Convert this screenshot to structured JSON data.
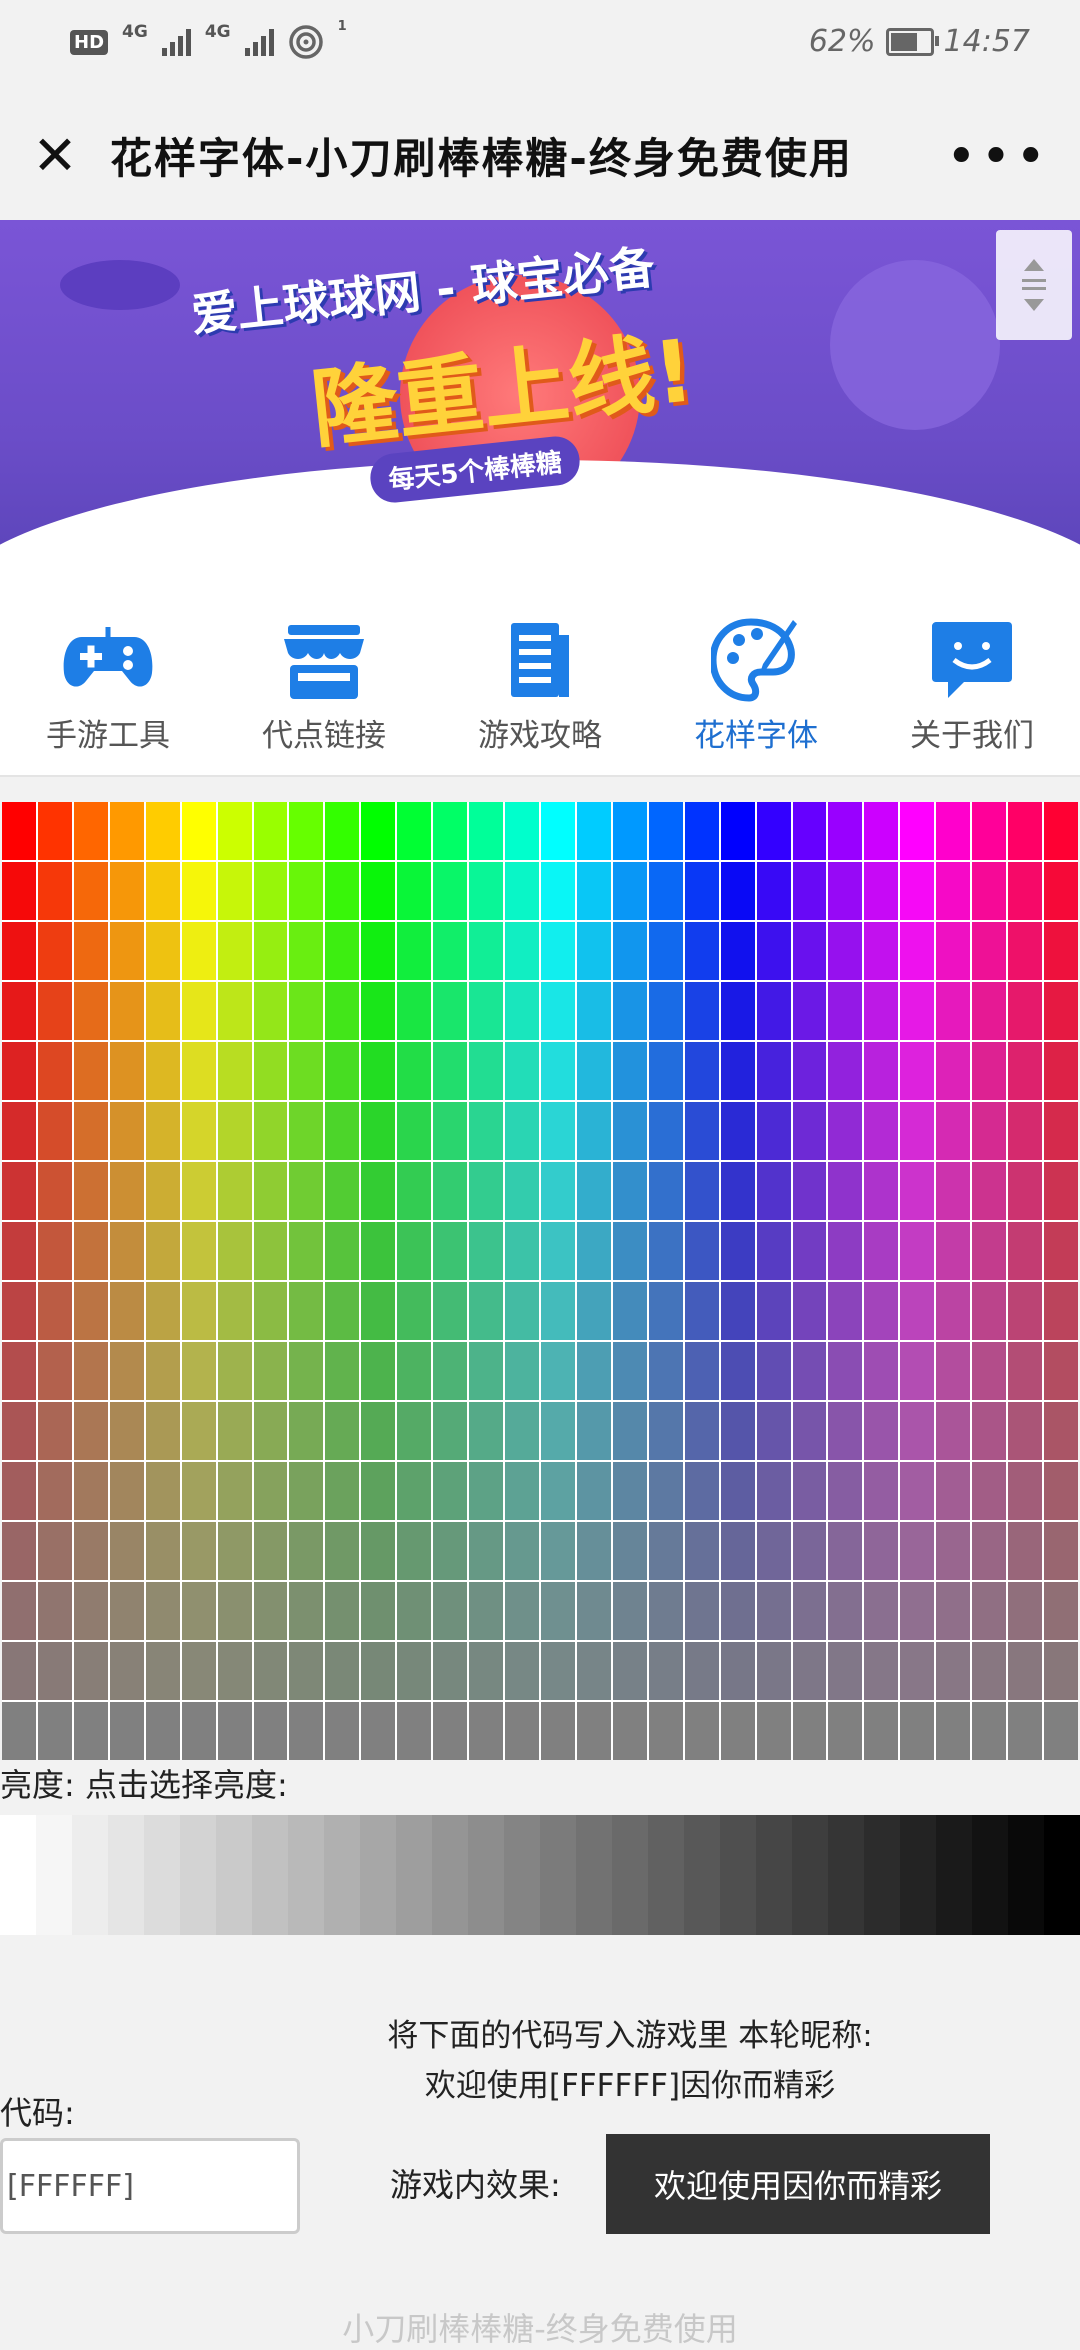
{
  "status_bar": {
    "hd": "HD",
    "net1": "4G",
    "net2": "4G",
    "hotspot_count": "1",
    "battery": "62%",
    "battery_level": 0.62,
    "time": "14:57"
  },
  "titlebar": {
    "title": "花样字体-小刀刷棒棒糖-终身免费使用",
    "close_icon": "close-icon",
    "more_icon": "more-icon"
  },
  "banner": {
    "line1": "爱上球球网 - 球宝必备",
    "line2": "隆重上线!",
    "line3": "每天5个棒棒糖"
  },
  "nav": {
    "items": [
      {
        "label": "手游工具",
        "icon": "gamepad-icon",
        "active": false
      },
      {
        "label": "代点链接",
        "icon": "store-icon",
        "active": false
      },
      {
        "label": "游戏攻略",
        "icon": "document-icon",
        "active": false
      },
      {
        "label": "花样字体",
        "icon": "palette-icon",
        "active": true
      },
      {
        "label": "关于我们",
        "icon": "chat-icon",
        "active": false
      }
    ]
  },
  "palette": {
    "columns": 30,
    "rows": 16
  },
  "brightness": {
    "label": "亮度:  点击选择亮度:"
  },
  "code": {
    "instruction1": "将下面的代码写入游戏里 本轮昵称:",
    "instruction2": "欢迎使用[FFFFFF]因你而精彩",
    "label": "代码:",
    "input_value": "[FFFFFF]",
    "effect_label": "游戏内效果:",
    "effect_text": "欢迎使用因你而精彩"
  },
  "footer": {
    "text": "小刀刷棒棒糖-终身免费使用"
  },
  "colors": {
    "accent": "#1e6fd0",
    "icon_blue": "#1e7ee6",
    "banner_purple": "#6b4dc8"
  }
}
